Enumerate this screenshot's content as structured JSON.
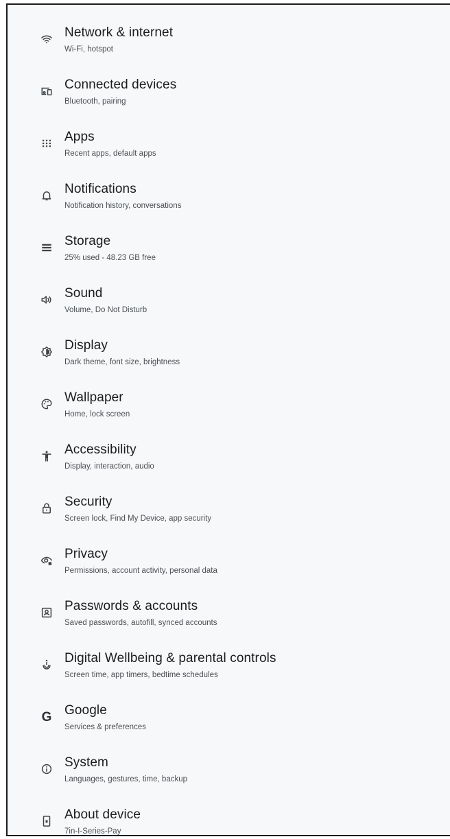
{
  "settings": {
    "items": [
      {
        "key": "network",
        "icon": "wifi-icon",
        "title": "Network & internet",
        "subtitle": "Wi-Fi, hotspot"
      },
      {
        "key": "connected-devices",
        "icon": "devices-icon",
        "title": "Connected devices",
        "subtitle": "Bluetooth, pairing"
      },
      {
        "key": "apps",
        "icon": "apps-grid-icon",
        "title": "Apps",
        "subtitle": "Recent apps, default apps"
      },
      {
        "key": "notifications",
        "icon": "bell-icon",
        "title": "Notifications",
        "subtitle": "Notification history, conversations"
      },
      {
        "key": "storage",
        "icon": "storage-icon",
        "title": "Storage",
        "subtitle": "25% used - 48.23 GB free"
      },
      {
        "key": "sound",
        "icon": "volume-icon",
        "title": "Sound",
        "subtitle": "Volume, Do Not Disturb"
      },
      {
        "key": "display",
        "icon": "brightness-icon",
        "title": "Display",
        "subtitle": "Dark theme, font size, brightness"
      },
      {
        "key": "wallpaper",
        "icon": "palette-icon",
        "title": "Wallpaper",
        "subtitle": "Home, lock screen"
      },
      {
        "key": "accessibility",
        "icon": "accessibility-icon",
        "title": "Accessibility",
        "subtitle": "Display, interaction, audio"
      },
      {
        "key": "security",
        "icon": "lock-icon",
        "title": "Security",
        "subtitle": "Screen lock, Find My Device, app security"
      },
      {
        "key": "privacy",
        "icon": "privacy-eye-icon",
        "title": "Privacy",
        "subtitle": "Permissions, account activity, personal data"
      },
      {
        "key": "passwords-accounts",
        "icon": "account-box-icon",
        "title": "Passwords & accounts",
        "subtitle": "Saved passwords, autofill, synced accounts"
      },
      {
        "key": "digital-wellbeing",
        "icon": "wellbeing-icon",
        "title": "Digital Wellbeing & parental controls",
        "subtitle": "Screen time, app timers, bedtime schedules"
      },
      {
        "key": "google",
        "icon": "google-g-icon",
        "title": "Google",
        "subtitle": "Services & preferences"
      },
      {
        "key": "system",
        "icon": "info-icon",
        "title": "System",
        "subtitle": "Languages, gestures, time, backup"
      },
      {
        "key": "about-device",
        "icon": "phone-icon",
        "title": "About device",
        "subtitle": "7in-I-Series-Pay"
      }
    ]
  },
  "colors": {
    "background": "#f7f8f9",
    "title_text": "#1b1c1e",
    "subtitle_text": "#4a4f54",
    "icon": "#3e4347"
  }
}
